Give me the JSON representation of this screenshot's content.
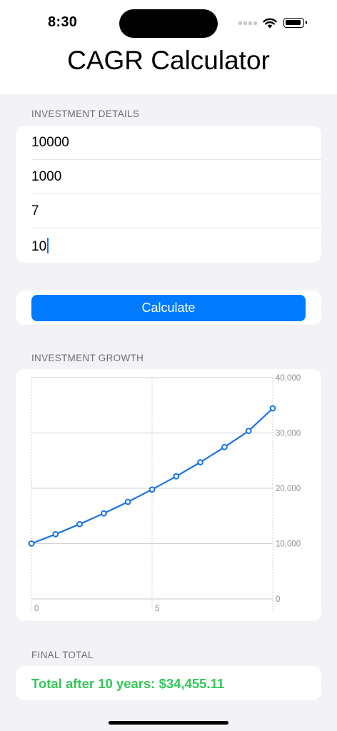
{
  "status_bar": {
    "time": "8:30"
  },
  "app": {
    "title": "CAGR Calculator"
  },
  "investment_details": {
    "section_label": "INVESTMENT DETAILS",
    "fields": [
      {
        "value": "10000"
      },
      {
        "value": "1000"
      },
      {
        "value": "7"
      },
      {
        "value": "10"
      }
    ]
  },
  "calculate": {
    "label": "Calculate",
    "color": "#007aff"
  },
  "growth": {
    "section_label": "INVESTMENT GROWTH"
  },
  "final": {
    "section_label": "FINAL TOTAL",
    "text": "Total after 10 years: $34,455.11",
    "color": "#34c759"
  },
  "chart_data": {
    "type": "line",
    "title": "",
    "xlabel": "",
    "ylabel": "",
    "x": [
      0,
      1,
      2,
      3,
      4,
      5,
      6,
      7,
      8,
      9,
      10
    ],
    "series": [
      {
        "values": [
          10000,
          11700,
          13519,
          15465,
          17548,
          19777,
          22161,
          24712,
          27442,
          30363,
          34455
        ]
      }
    ],
    "xlim": [
      0,
      10
    ],
    "ylim": [
      0,
      40000
    ],
    "x_ticks": [
      "0",
      "5"
    ],
    "y_ticks": [
      "0",
      "10,000",
      "20,000",
      "30,000",
      "40,000"
    ],
    "y_tick_values": [
      0,
      10000,
      20000,
      30000,
      40000
    ],
    "x_tick_values": [
      0,
      5
    ],
    "line_color": "#1a73e8",
    "grid": true,
    "y_axis_position": "right"
  }
}
